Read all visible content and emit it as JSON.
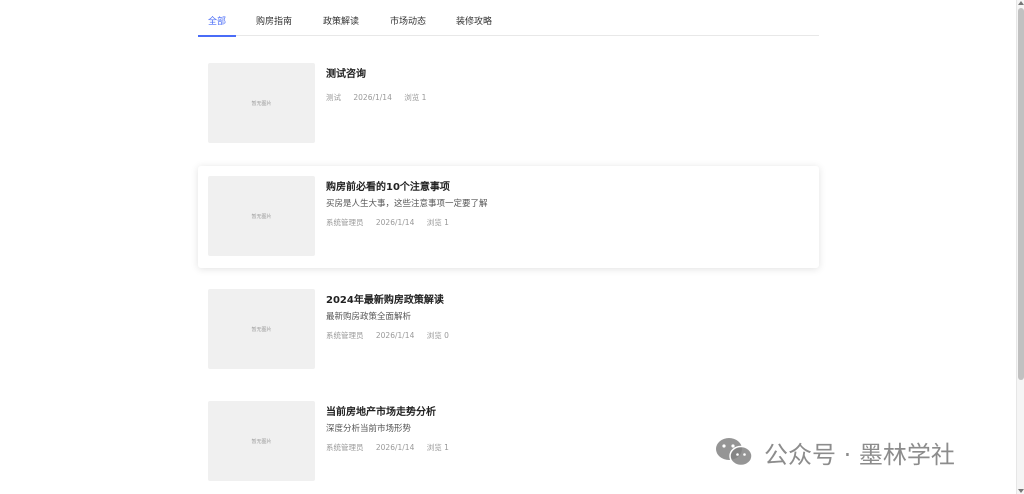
{
  "tabs": [
    {
      "label": "全部",
      "active": true
    },
    {
      "label": "购房指南",
      "active": false
    },
    {
      "label": "政策解读",
      "active": false
    },
    {
      "label": "市场动态",
      "active": false
    },
    {
      "label": "装修攻略",
      "active": false
    }
  ],
  "placeholder_image_text": "暂无图片",
  "articles": [
    {
      "title": "测试咨询",
      "summary": "",
      "author": "测试",
      "date": "2026/1/14",
      "views": "浏览 1"
    },
    {
      "title": "购房前必看的10个注意事项",
      "summary": "买房是人生大事，这些注意事项一定要了解",
      "author": "系统管理员",
      "date": "2026/1/14",
      "views": "浏览 1"
    },
    {
      "title": "2024年最新购房政策解读",
      "summary": "最新购房政策全面解析",
      "author": "系统管理员",
      "date": "2026/1/14",
      "views": "浏览 0"
    },
    {
      "title": "当前房地产市场走势分析",
      "summary": "深度分析当前市场形势",
      "author": "系统管理员",
      "date": "2026/1/14",
      "views": "浏览 1"
    }
  ],
  "watermark": {
    "text": "公众号 · 墨林学社",
    "icon": "wechat-icon"
  },
  "colors": {
    "accent": "#4a6cf7",
    "thumb_bg": "#f0f0f0"
  }
}
